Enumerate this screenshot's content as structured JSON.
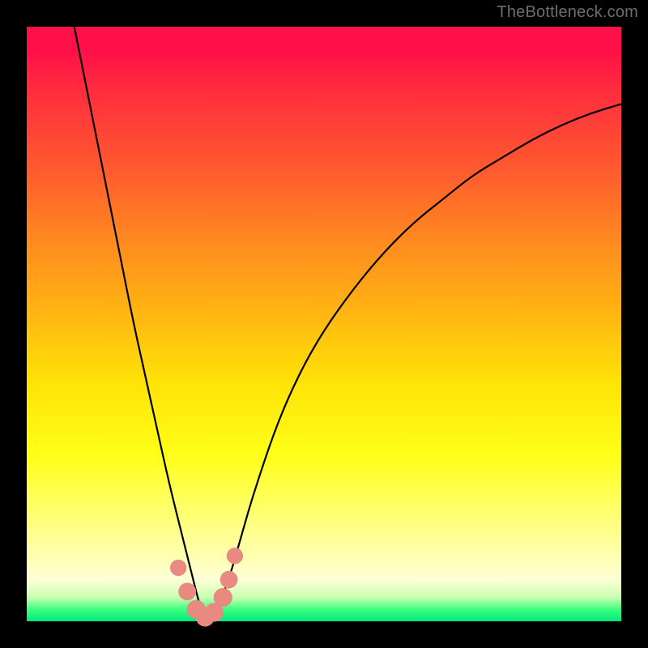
{
  "watermark": "TheBottleneck.com",
  "chart_data": {
    "type": "line",
    "title": "",
    "xlabel": "",
    "ylabel": "",
    "xlim": [
      0,
      100
    ],
    "ylim": [
      0,
      100
    ],
    "grid": false,
    "series": [
      {
        "name": "bottleneck-curve",
        "x": [
          8,
          10,
          12,
          14,
          16,
          18,
          20,
          22,
          24,
          26,
          28,
          29,
          30,
          31,
          32,
          34,
          36,
          38,
          42,
          46,
          50,
          55,
          60,
          65,
          70,
          75,
          80,
          85,
          90,
          95,
          100
        ],
        "y": [
          100,
          90,
          80,
          70,
          60,
          50,
          41,
          32,
          23,
          15,
          7,
          3,
          0.5,
          0.5,
          2,
          7,
          14,
          21,
          33,
          42,
          49,
          56,
          62,
          67,
          71,
          75,
          78,
          81,
          83.5,
          85.5,
          87
        ]
      }
    ],
    "markers": {
      "name": "bottom-dots",
      "color": "#e98a82",
      "points": [
        {
          "x": 25.5,
          "y": 9,
          "r": 1.4
        },
        {
          "x": 27,
          "y": 5,
          "r": 1.6
        },
        {
          "x": 28.5,
          "y": 2,
          "r": 1.8
        },
        {
          "x": 30,
          "y": 0.7,
          "r": 1.8
        },
        {
          "x": 31.5,
          "y": 1.5,
          "r": 1.8
        },
        {
          "x": 33,
          "y": 4,
          "r": 1.8
        },
        {
          "x": 34,
          "y": 7,
          "r": 1.6
        },
        {
          "x": 35,
          "y": 11,
          "r": 1.4
        }
      ]
    }
  }
}
